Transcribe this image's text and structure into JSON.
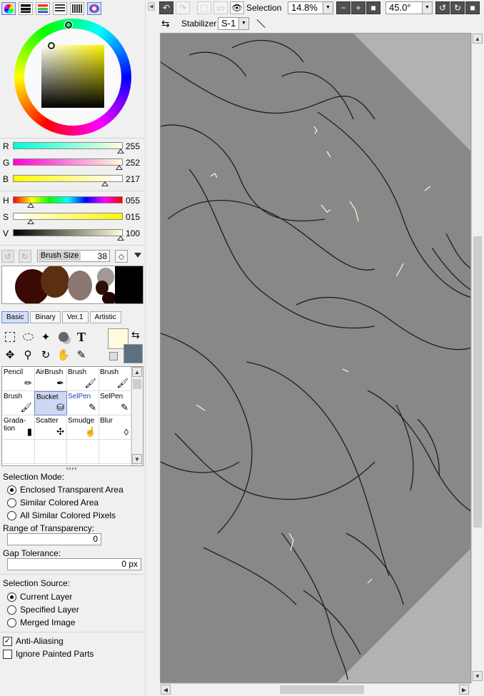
{
  "color_panel": {
    "r": {
      "label": "R",
      "value": "255"
    },
    "g": {
      "label": "G",
      "value": "252"
    },
    "b": {
      "label": "B",
      "value": "217"
    },
    "h": {
      "label": "H",
      "value": "055"
    },
    "s": {
      "label": "S",
      "value": "015"
    },
    "v": {
      "label": "V",
      "value": "100"
    }
  },
  "brush_size": {
    "label": "Brush Size",
    "value": "38"
  },
  "brush_tabs": [
    "Basic",
    "Binary",
    "Ver.1",
    "Artistic"
  ],
  "colors": {
    "foreground": "#fffbdd",
    "background": "#5b7080",
    "canvas_gray": "#888888"
  },
  "tools": [
    {
      "row": 0,
      "cells": [
        {
          "name": "Pencil",
          "icon": "pencil-icon"
        },
        {
          "name": "AirBrush",
          "icon": "airbrush-icon"
        },
        {
          "name": "Brush",
          "icon": "brush-icon"
        },
        {
          "name": "Brush",
          "icon": "brush-icon"
        }
      ]
    },
    {
      "row": 1,
      "cells": [
        {
          "name": "Brush",
          "icon": "brush-icon"
        },
        {
          "name": "Bucket",
          "icon": "bucket-icon",
          "selected": true
        },
        {
          "name": "SelPen",
          "icon": "selpen-icon",
          "blue": true
        },
        {
          "name": "SelPen",
          "icon": "selpen-icon"
        }
      ]
    },
    {
      "row": 2,
      "cells": [
        {
          "name": "Grada-\ntion",
          "icon": "gradation-icon"
        },
        {
          "name": "Scatter",
          "icon": "scatter-icon"
        },
        {
          "name": "Smudge",
          "icon": "smudge-icon"
        },
        {
          "name": "Blur",
          "icon": "blur-icon"
        }
      ]
    }
  ],
  "options": {
    "selection_mode_label": "Selection Mode:",
    "selection_mode": [
      "Enclosed Transparent Area",
      "Similar Colored Area",
      "All Similar Colored Pixels"
    ],
    "range_label": "Range of Transparency:",
    "range_value": "0",
    "gap_label": "Gap Tolerance:",
    "gap_value": "0 px",
    "source_label": "Selection Source:",
    "source": [
      "Current Layer",
      "Specified Layer",
      "Merged Image"
    ],
    "anti_aliasing": "Anti-Aliasing",
    "ignore_painted": "Ignore Painted Parts"
  },
  "toolbar": {
    "selection_label": "Selection",
    "zoom": "14.8%",
    "angle": "45.0°",
    "stabilizer_label": "Stabilizer",
    "stabilizer_value": "S-1"
  }
}
